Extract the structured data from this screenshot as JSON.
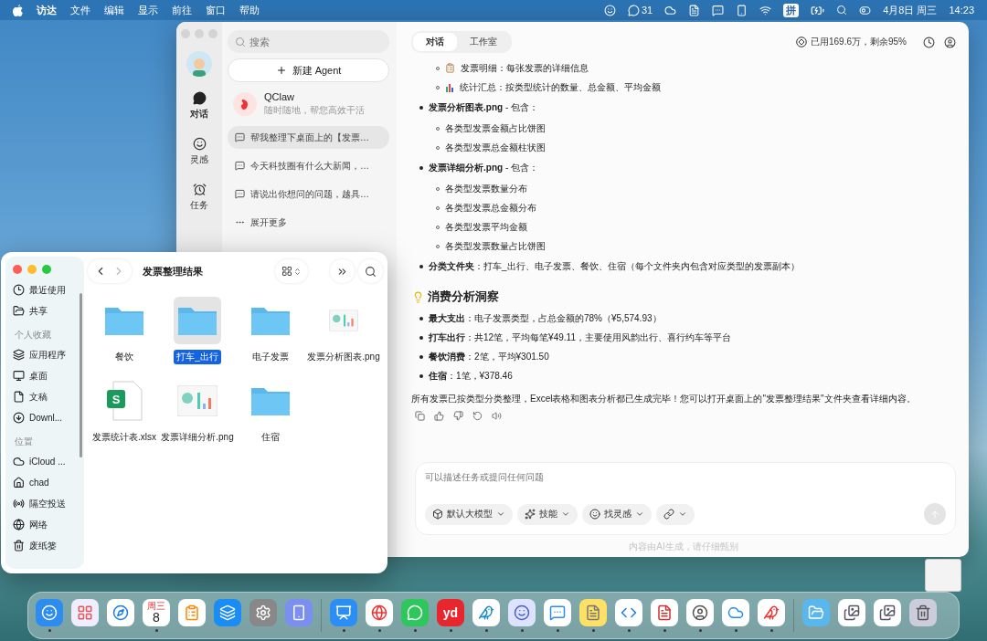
{
  "menubar": {
    "app": "访达",
    "menus": [
      "文件",
      "编辑",
      "显示",
      "前往",
      "窗口",
      "帮助"
    ],
    "badge": "31",
    "input_method": "拼",
    "date": "4月8日 周三",
    "time": "14:23"
  },
  "chat_window": {
    "search": {
      "placeholder": "搜索"
    },
    "new_agent": "新建 Agent",
    "nav": [
      {
        "kind": "chat",
        "label": "对话",
        "selected": true
      },
      {
        "kind": "idea",
        "label": "灵感",
        "selected": false
      },
      {
        "kind": "task",
        "label": "任务",
        "selected": false
      }
    ],
    "agent": {
      "name": "QClaw",
      "subtitle": "随时随地，帮您高效干活"
    },
    "conversations": [
      {
        "title": "帮我整理下桌面上的【发票…",
        "selected": true
      },
      {
        "title": "今天科技圈有什么大新闻，…",
        "selected": false
      },
      {
        "title": "请说出你想问的问题，越具…",
        "selected": false
      }
    ],
    "more": "展开更多",
    "tabs": [
      {
        "label": "对话",
        "selected": true
      },
      {
        "label": "工作室",
        "selected": false
      }
    ],
    "usage": "已用169.6万，剩余95%",
    "message": {
      "list": [
        {
          "children": [
            {
              "kind": "memo",
              "text": "发票明细：每张发票的详细信息"
            },
            {
              "kind": "chart",
              "text": "统计汇总：按类型统计的数量、总金额、平均金额"
            }
          ]
        },
        {
          "text": "**发票分析图表.png** - 包含：",
          "children": [
            {
              "kind": "plain",
              "text": "各类型发票金额占比饼图"
            },
            {
              "kind": "plain",
              "text": "各类型发票总金额柱状图"
            }
          ]
        },
        {
          "text": "**发票详细分析.png** - 包含：",
          "children": [
            {
              "kind": "plain",
              "text": "各类型发票数量分布"
            },
            {
              "kind": "plain",
              "text": "各类型发票总金额分布"
            },
            {
              "kind": "plain",
              "text": "各类型发票平均金额"
            },
            {
              "kind": "plain",
              "text": "各类型发票数量占比饼图"
            }
          ]
        },
        {
          "text": "**分类文件夹**：打车_出行、电子发票、餐饮、住宿（每个文件夹内包含对应类型的发票副本）"
        }
      ],
      "heading": "消费分析洞察",
      "insights": [
        "**最大支出**：电子发票类型，占总金额的78%（¥5,574.93）",
        "**打车出行**：共12笔，平均每笔¥49.11，主要使用风韵出行、喜行约车等平台",
        "**餐饮消费**：2笔，平均¥301.50",
        "**住宿**：1笔，¥378.46"
      ],
      "summary": "所有发票已按类型分类整理，Excel表格和图表分析都已生成完毕！您可以打开桌面上的\"发票整理结果\"文件夹查看详细内容。"
    },
    "input": {
      "placeholder": "可以描述任务或提问任何问题"
    },
    "tools": [
      {
        "kind": "model",
        "label": "默认大模型"
      },
      {
        "kind": "skill",
        "label": "技能"
      },
      {
        "kind": "idea",
        "label": "找灵感"
      },
      {
        "kind": "link"
      }
    ],
    "disclaimer": "内容由AI生成，请仔细甄别"
  },
  "finder": {
    "title": "发票整理结果",
    "sidebar": [
      {
        "items": [
          {
            "kind": "recent",
            "label": "最近使用"
          },
          {
            "kind": "shared",
            "label": "共享"
          }
        ]
      },
      {
        "heading": "个人收藏",
        "items": [
          {
            "kind": "apps",
            "label": "应用程序"
          },
          {
            "kind": "desktop",
            "label": "桌面"
          },
          {
            "kind": "documents",
            "label": "文稿"
          },
          {
            "kind": "downloads",
            "label": "Downl..."
          }
        ]
      },
      {
        "heading": "位置",
        "items": [
          {
            "kind": "icloud",
            "label": "iCloud ..."
          },
          {
            "kind": "home",
            "label": "chad"
          },
          {
            "kind": "airdrop",
            "label": "隔空投送"
          },
          {
            "kind": "network",
            "label": "网络"
          },
          {
            "kind": "trash",
            "label": "废纸篓"
          }
        ]
      }
    ],
    "files": [
      {
        "kind": "folder",
        "name": "餐饮",
        "selected": false
      },
      {
        "kind": "folder",
        "name": "打车_出行",
        "selected": true
      },
      {
        "kind": "folder",
        "name": "电子发票",
        "selected": false
      },
      {
        "kind": "image",
        "name": "发票分析图表.png",
        "selected": false
      },
      {
        "kind": "sheet",
        "name": "发票统计表.xlsx",
        "badge": "S",
        "selected": false
      },
      {
        "kind": "image2",
        "name": "发票详细分析.png",
        "selected": false
      },
      {
        "kind": "folder",
        "name": "住宿",
        "selected": false
      }
    ]
  },
  "dock": [
    {
      "kind": "finder",
      "running": true
    },
    {
      "kind": "launchpad",
      "running": false
    },
    {
      "kind": "safari",
      "running": false
    },
    {
      "kind": "calendar",
      "weekday": "周三",
      "day": "8",
      "running": true
    },
    {
      "kind": "reminders",
      "running": false
    },
    {
      "kind": "appstore",
      "running": false
    },
    {
      "kind": "settings",
      "running": false
    },
    {
      "kind": "mirror",
      "running": false
    },
    {
      "kind": "separator"
    },
    {
      "kind": "keynote",
      "running": true
    },
    {
      "kind": "chrome",
      "running": true
    },
    {
      "kind": "wechat",
      "running": true
    },
    {
      "kind": "youdao",
      "text": "yd",
      "running": true
    },
    {
      "kind": "bird",
      "running": true
    },
    {
      "kind": "face",
      "running": true
    },
    {
      "kind": "bubble",
      "running": true
    },
    {
      "kind": "notes",
      "running": true
    },
    {
      "kind": "vscode",
      "running": true
    },
    {
      "kind": "textedit",
      "running": true
    },
    {
      "kind": "avatar",
      "running": true
    },
    {
      "kind": "cloud",
      "running": true
    },
    {
      "kind": "qclaw",
      "running": true
    },
    {
      "kind": "separator"
    },
    {
      "kind": "folder",
      "running": false
    },
    {
      "kind": "doc",
      "running": false
    },
    {
      "kind": "doc",
      "running": false
    },
    {
      "kind": "trash",
      "running": false
    }
  ]
}
